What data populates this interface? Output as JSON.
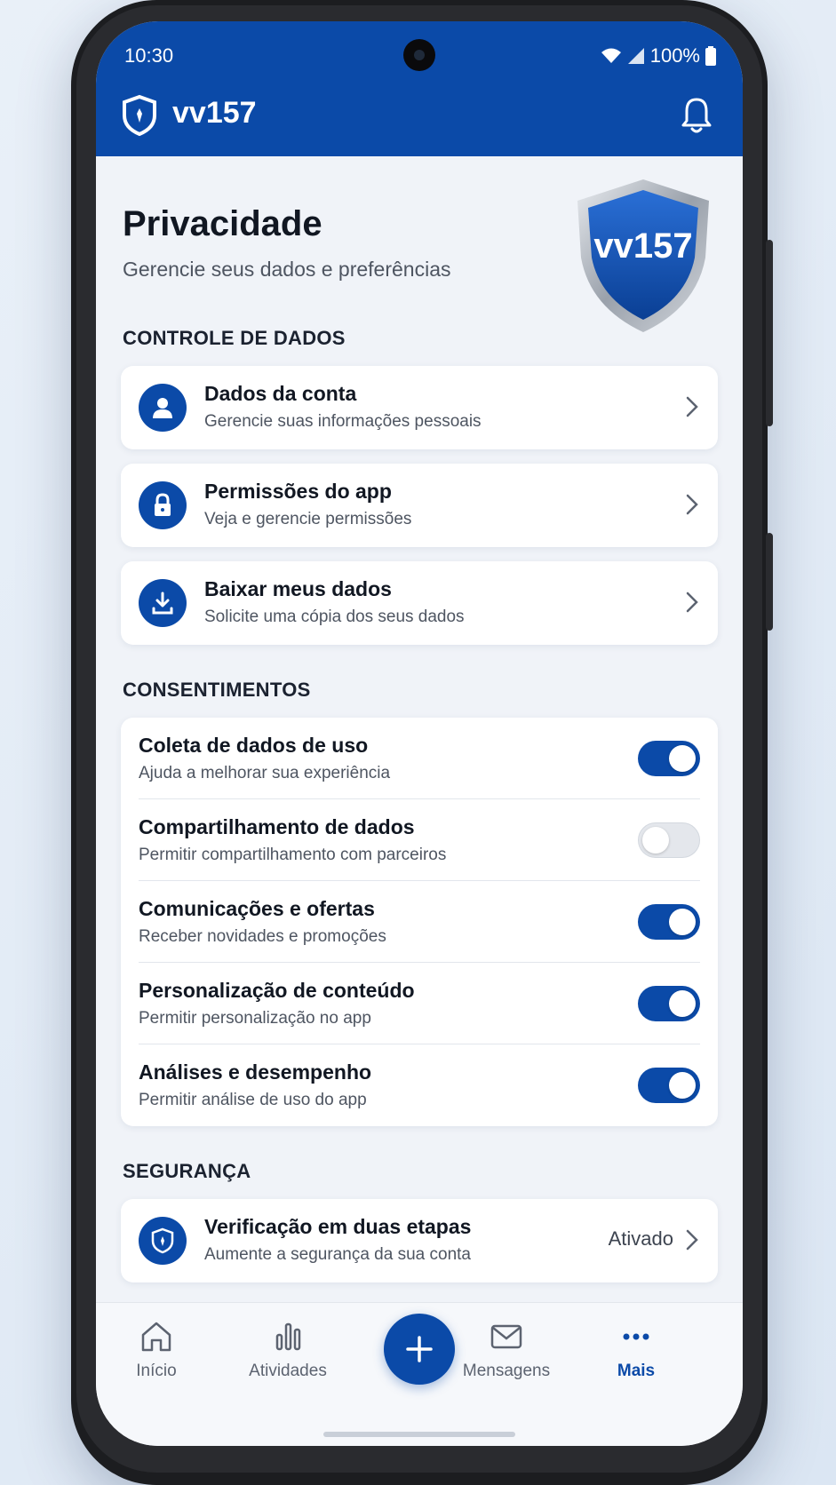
{
  "status_bar": {
    "time": "10:30",
    "battery": "100%"
  },
  "app": {
    "name": "vv157",
    "accent_color": "#0b4aa8"
  },
  "header": {
    "title": "Privacidade",
    "subtitle": "Gerencie seus dados e preferências",
    "shield_text": "vv157"
  },
  "data_control": {
    "section_title": "CONTROLE DE DADOS",
    "items": [
      {
        "icon": "person-icon",
        "title": "Dados da conta",
        "subtitle": "Gerencie suas informações pessoais"
      },
      {
        "icon": "lock-icon",
        "title": "Permissões do app",
        "subtitle": "Veja e gerencie permissões"
      },
      {
        "icon": "download-icon",
        "title": "Baixar meus dados",
        "subtitle": "Solicite uma cópia dos seus dados"
      }
    ]
  },
  "consents": {
    "section_title": "CONSENTIMENTOS",
    "items": [
      {
        "title": "Coleta de dados de uso",
        "subtitle": "Ajuda a melhorar sua experiência",
        "enabled": true
      },
      {
        "title": "Compartilhamento de dados",
        "subtitle": "Permitir compartilhamento com parceiros",
        "enabled": false
      },
      {
        "title": "Comunicações e ofertas",
        "subtitle": "Receber novidades e promoções",
        "enabled": true
      },
      {
        "title": "Personalização de conteúdo",
        "subtitle": "Permitir personalização no app",
        "enabled": true
      },
      {
        "title": "Análises e desempenho",
        "subtitle": "Permitir análise de uso do app",
        "enabled": true
      }
    ]
  },
  "security": {
    "section_title": "SEGURANÇA",
    "item": {
      "icon": "shield-icon",
      "title": "Verificação em duas etapas",
      "subtitle": "Aumente a segurança da sua conta",
      "status": "Ativado"
    }
  },
  "bottom_nav": {
    "items": [
      {
        "icon": "home-icon",
        "label": "Início"
      },
      {
        "icon": "activity-icon",
        "label": "Atividades"
      },
      {
        "icon": "mail-icon",
        "label": "Mensagens"
      },
      {
        "icon": "more-icon",
        "label": "Mais",
        "active": true
      }
    ],
    "fab_icon": "plus-icon"
  }
}
